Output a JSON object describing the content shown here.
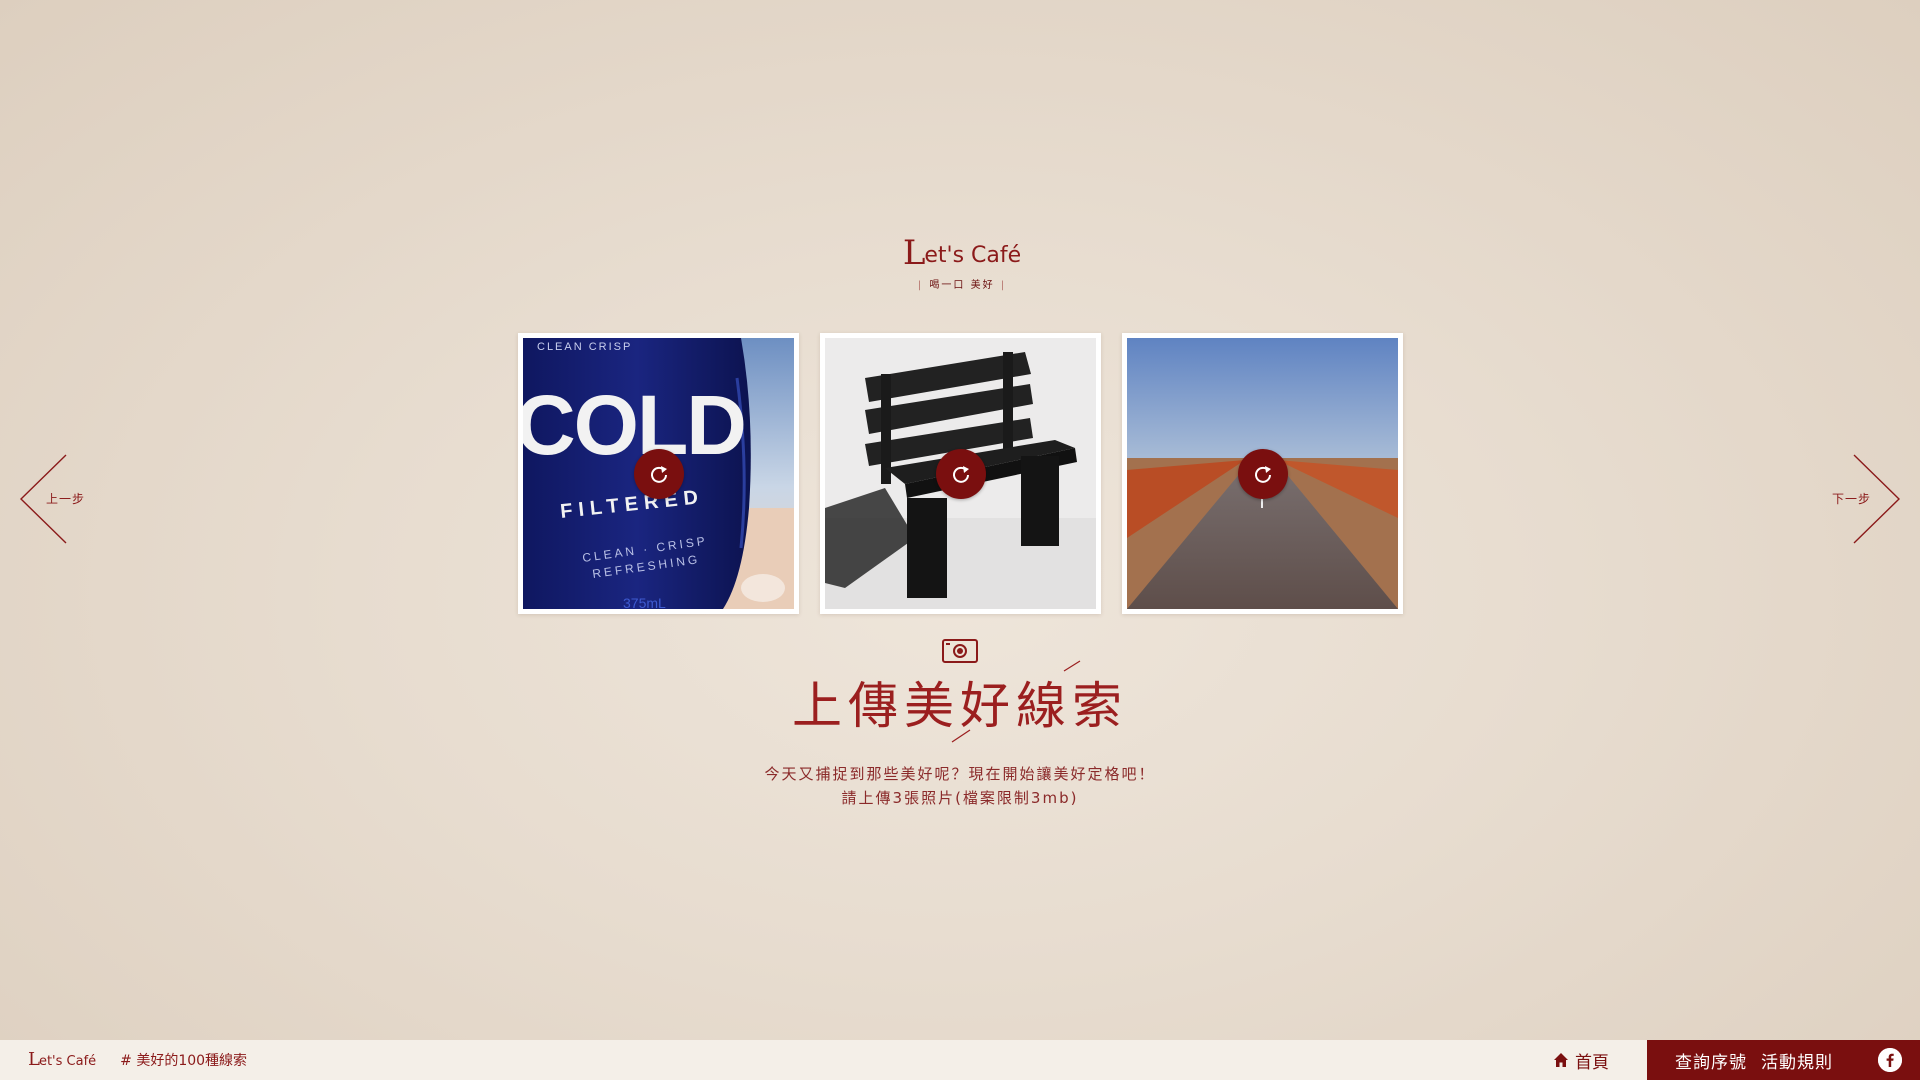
{
  "logo": {
    "prefix": "L",
    "word": "et's Café",
    "tagline": "喝一口 美好"
  },
  "photos": [
    {
      "alt": "COLD FILTERED bottle",
      "bottle_text_1": "COLD",
      "bottle_text_2": "FILTERED",
      "bottle_text_3": "CLEAN · CRISP",
      "bottle_text_4": "REFRESHING",
      "bottle_text_5": "375mL",
      "top_text": "CLEAN   CRISP"
    },
    {
      "alt": "black bench on sand"
    },
    {
      "alt": "desert road"
    }
  ],
  "icons": {
    "reload": "reload-icon",
    "camera": "camera-icon",
    "home": "home-icon",
    "facebook": "facebook-icon"
  },
  "nav": {
    "prev_label": "上一步",
    "next_label": "下一步"
  },
  "main": {
    "headline": "上傳美好線索",
    "desc_line1": "今天又捕捉到那些美好呢？現在開始讓美好定格吧！",
    "desc_line2": "請上傳3張照片(檔案限制3mb)"
  },
  "footer": {
    "logo_prefix": "L",
    "logo_word": "et's Café",
    "hashtag": "# 美好的100種線索",
    "home": "首頁",
    "query_serial": "查詢序號",
    "rules": "活動規則"
  },
  "colors": {
    "accent": "#7a0f0f",
    "text": "#8b1a1a",
    "background": "#e7dccf"
  }
}
